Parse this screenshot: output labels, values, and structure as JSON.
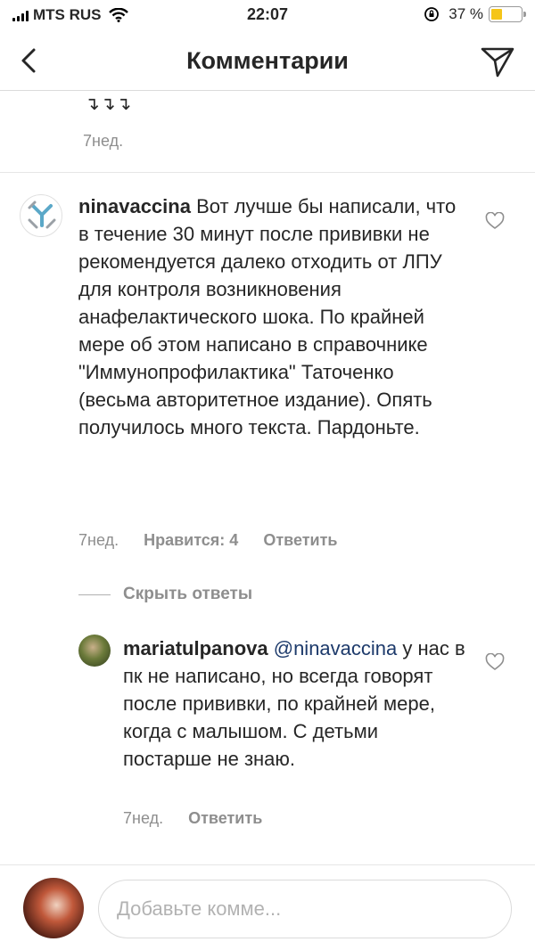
{
  "status_bar": {
    "carrier": "MTS RUS",
    "time": "22:07",
    "battery": "37 %",
    "battery_level": 0.37
  },
  "nav": {
    "title": "Комментарии"
  },
  "previous_comment": {
    "text": "↴↴↴",
    "time": "7нед."
  },
  "comments": [
    {
      "username": "ninavaccina",
      "text": "Вот лучше бы написали, что в течение 30 минут после прививки не рекомендуется далеко отходить от ЛПУ для контроля возникновения анафелактического шока. По крайней мере об этом написано в справочнике \"Иммунопрофилактика\" Таточенко (весьма авторитетное издание). Опять получилось много текста. Пардоньте.",
      "time": "7нед.",
      "likes": "Нравится: 4",
      "reply_label": "Ответить"
    }
  ],
  "hide_replies_label": "Скрыть ответы",
  "replies": [
    {
      "username": "mariatulpanova",
      "mention": "@ninavaccina",
      "text": "у нас в пк не написано, но всегда говорят после прививки, по крайней мере, когда с малышом. С детьми постарше не знаю.",
      "time": "7нед.",
      "reply_label": "Ответить"
    }
  ],
  "composer": {
    "placeholder": "Добавьте комме...",
    "value": ""
  }
}
